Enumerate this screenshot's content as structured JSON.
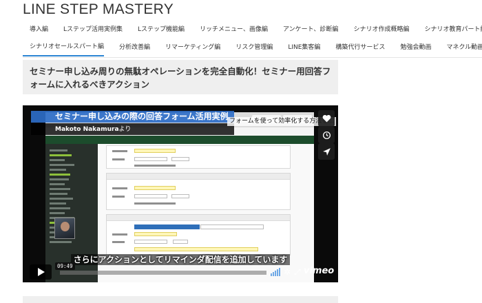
{
  "site": {
    "title": "LINE STEP MASTERY"
  },
  "nav": {
    "row1": [
      "導入編",
      "Lステップ活用実例集",
      "Lステップ機能編",
      "リッチメニュー、画像編",
      "アンケート、診断編",
      "シナリオ作成概略編",
      "シナリオ教育パート編"
    ],
    "row2": [
      "シナリオセールスパート編",
      "分析改善編",
      "リマーケティング編",
      "リスク管理編",
      "LINE集客編",
      "構築代行サービス",
      "勉強会動画",
      "マネクル動画"
    ],
    "active": "シナリオセールスパート編"
  },
  "post": {
    "title": "セミナー申し込み周りの無駄オペレーションを完全自動化！セミナー用回答フォームに入れるべきアクション"
  },
  "video": {
    "banner_title": "セミナー申し込みの際の回答フォーム活用実例",
    "author_name": "Makoto Nakamura",
    "author_suffix": "より",
    "overlay_text": "フォームを使って効率化する方法を…",
    "subtitle": "さらにアクションとしてリマインダ配信を追加しています",
    "timestamp": "09:49",
    "progress": 0.0,
    "brand": "vimeo",
    "icons": [
      "heart-icon",
      "clock-icon",
      "send-icon",
      "play-icon",
      "settings-icon",
      "fullscreen-icon",
      "volume-icon"
    ]
  }
}
